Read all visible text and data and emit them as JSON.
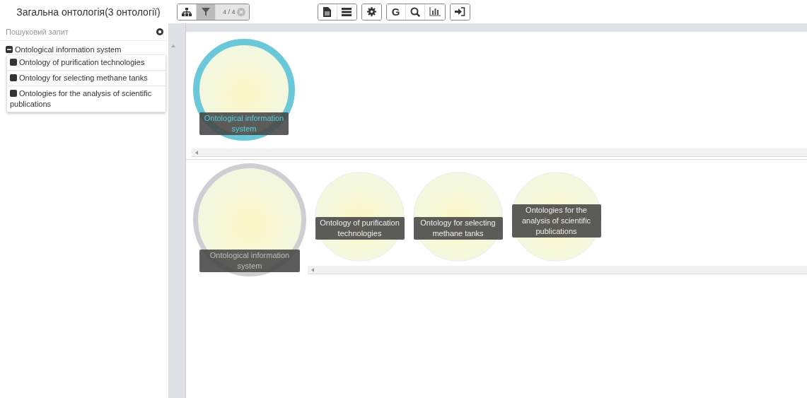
{
  "header": {
    "title": "Загальна онтологія(3 онтології)"
  },
  "toolbar": {
    "filter": {
      "selected": true
    },
    "counter": "4 / 4",
    "google_key": "G"
  },
  "sidebar": {
    "search": {
      "placeholder": "Пошуковий запит"
    },
    "tree": [
      {
        "label": "Ontological information system",
        "expanded": true,
        "children": [
          {
            "label": "Ontology of purification technologies",
            "expanded": false
          },
          {
            "label": "Ontology for selecting methane tanks",
            "expanded": false
          },
          {
            "label": "Ontologies for the analysis of scientific publications",
            "expanded": false
          }
        ]
      }
    ]
  },
  "graph_panels": [
    {
      "nodes": [
        {
          "label": "Ontological information system",
          "kind": "focused"
        }
      ]
    },
    {
      "nodes": [
        {
          "label": "Ontological information system",
          "kind": "parent"
        },
        {
          "label": "Ontology of purification technologies",
          "kind": "child"
        },
        {
          "label": "Ontology for selecting methane tanks",
          "kind": "child"
        },
        {
          "label": "Ontologies for the analysis of scientific publications",
          "kind": "child"
        }
      ]
    }
  ]
}
